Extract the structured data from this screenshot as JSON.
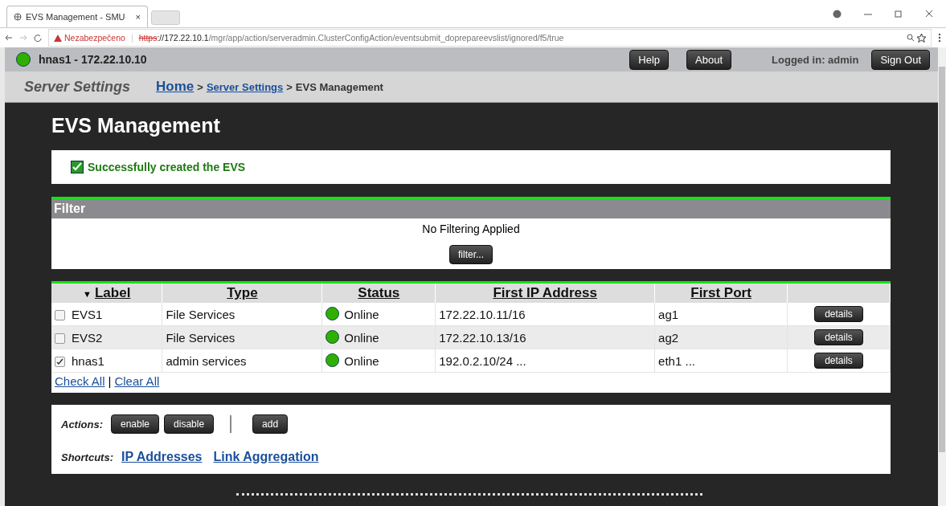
{
  "browser": {
    "tab_title": "EVS Management - SMU",
    "tab_close": "×",
    "security_label": "Nezabezpečeno",
    "url_divider": "|",
    "url_scheme": "https",
    "url_host": "://172.22.10.1",
    "url_path": "/mgr/app/action/serveradmin.ClusterConfigAction/eventsubmit_doprepareevslist/ignored/f5/true"
  },
  "header": {
    "host": "hnas1 - 172.22.10.10",
    "online": true,
    "buttons": [
      "Help",
      "About"
    ],
    "logged_in": "Logged in: admin",
    "sign_out": "Sign Out"
  },
  "breadcrumb": {
    "section": "Server Settings",
    "items": [
      {
        "label": "Home",
        "kind": "home"
      },
      {
        "label": "Server Settings",
        "kind": "link"
      },
      {
        "label": "EVS Management",
        "kind": "current"
      }
    ],
    "separator": ">"
  },
  "page_title": "EVS Management",
  "message": {
    "text": "Successfully created the EVS",
    "kind": "success"
  },
  "filter": {
    "title": "Filter",
    "status": "No Filtering Applied",
    "button": "filter..."
  },
  "table": {
    "columns": [
      {
        "label": "Label",
        "sort_arrow": "▼"
      },
      {
        "label": "Type"
      },
      {
        "label": "Status"
      },
      {
        "label": "First IP Address"
      },
      {
        "label": "First Port"
      }
    ],
    "rows": [
      {
        "label": "EVS1",
        "checked": false,
        "type": "File Services",
        "status": "Online",
        "color": "#2fb000",
        "ip": "172.22.10.11/16",
        "port": "ag1",
        "action": "details"
      },
      {
        "label": "EVS2",
        "checked": false,
        "type": "File Services",
        "status": "Online",
        "color": "#2fb000",
        "ip": "172.22.10.13/16",
        "port": "ag2",
        "action": "details"
      },
      {
        "label": "hnas1",
        "checked": true,
        "type": "admin services",
        "status": "Online",
        "color": "#2fb000",
        "ip": "192.0.2.10/24 ...",
        "port": "eth1 ...",
        "action": "details"
      }
    ],
    "check_all": "Check All",
    "divider": "|",
    "clear_all": "Clear All"
  },
  "actions": {
    "label": "Actions:",
    "buttons": [
      {
        "label": "enable",
        "separator_before": false
      },
      {
        "label": "disable",
        "separator_before": false
      },
      {
        "label": "add",
        "separator_before": true
      }
    ]
  },
  "shortcuts": {
    "label": "Shortcuts:",
    "links": [
      "IP Addresses",
      "Link Aggregation"
    ]
  }
}
